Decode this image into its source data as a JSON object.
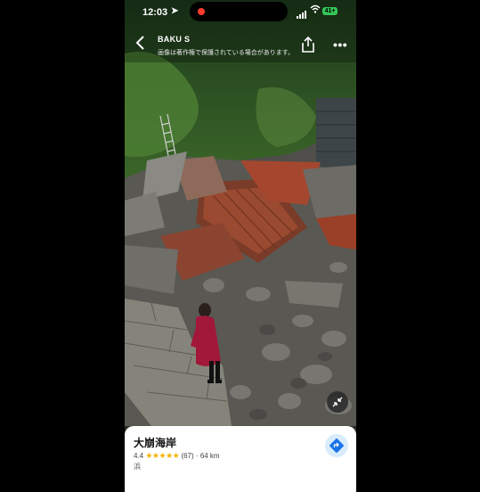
{
  "status_bar": {
    "time": "12:03",
    "battery": "41+"
  },
  "header": {
    "author": "BAKU S",
    "copyright_notice": "画像は著作権で保護されている場合があります。",
    "back_icon": "chevron-left-icon",
    "share_icon": "share-icon",
    "more_icon": "more-horizontal-icon"
  },
  "photo": {
    "subject": "collapsed-building-on-rocky-shore"
  },
  "place_card": {
    "name": "大崩海岸",
    "rating": "4.4",
    "stars": "★★★★★",
    "review_count": "(67)",
    "separator": "·",
    "distance": "64 km",
    "category": "浜",
    "directions_icon": "directions-icon"
  },
  "colors": {
    "accent_blue": "#1a73e8",
    "star_yellow": "#f4b400",
    "recording_red": "#ff3b30",
    "battery_green": "#34c759"
  }
}
